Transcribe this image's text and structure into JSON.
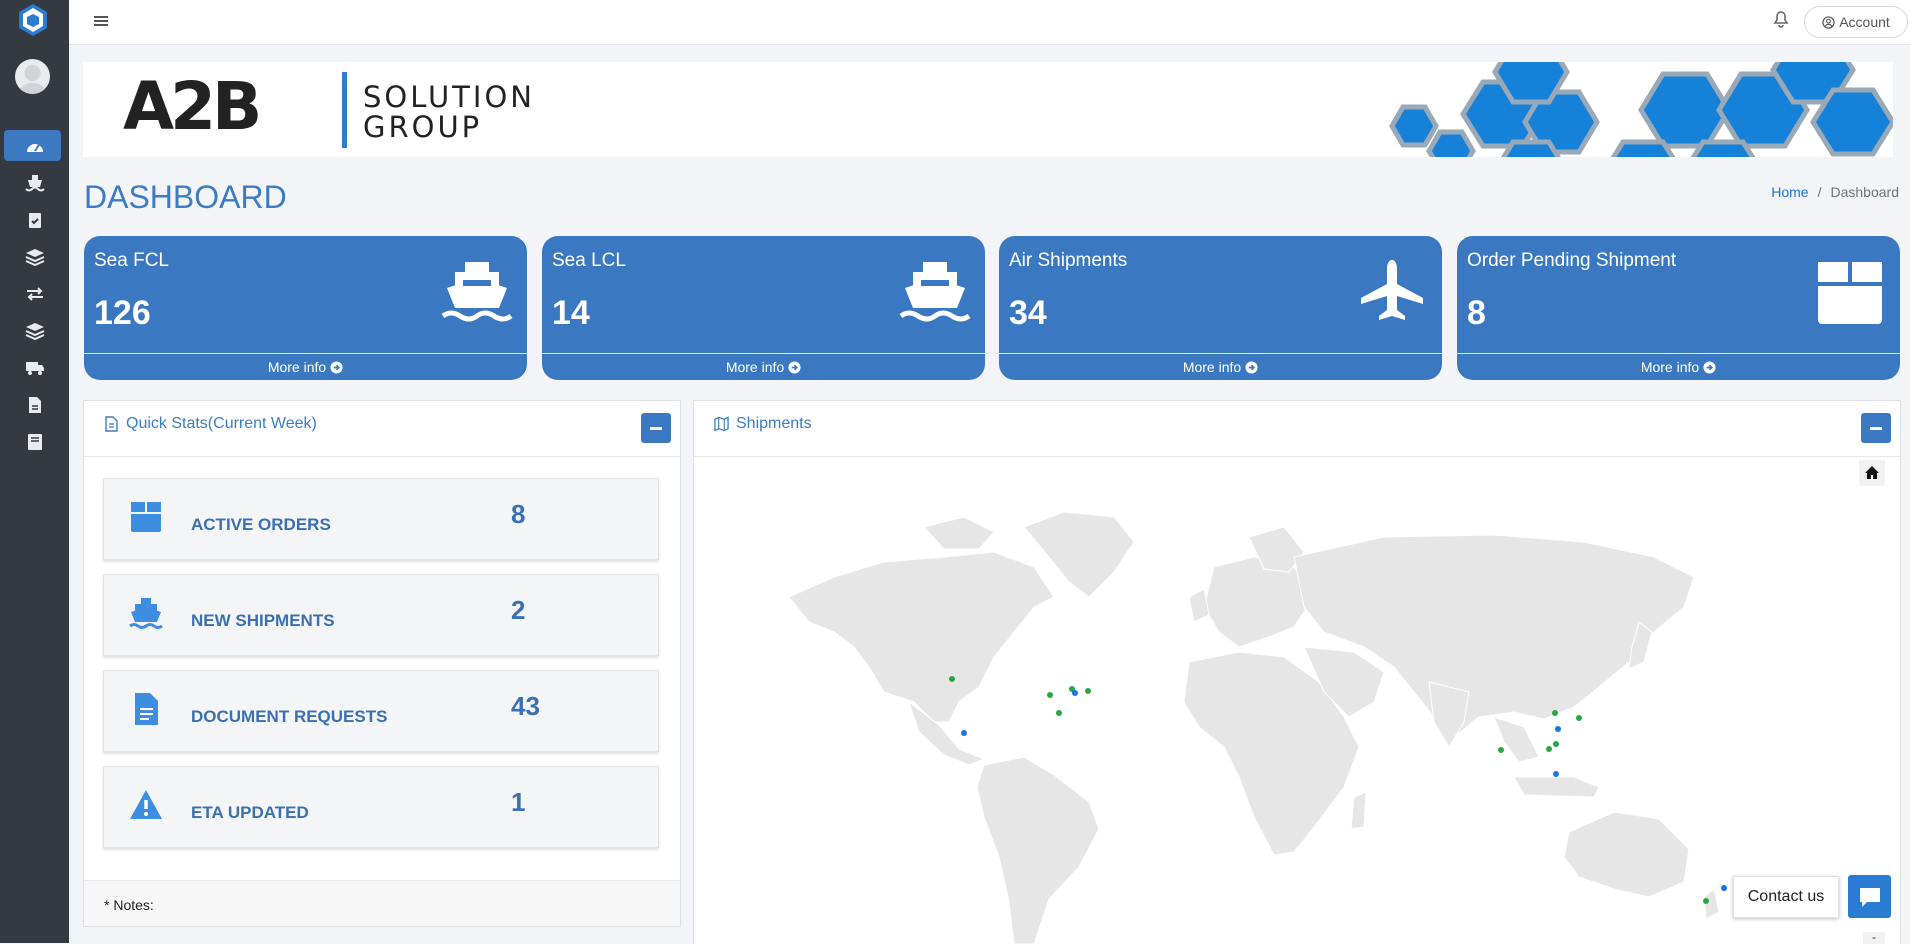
{
  "topbar": {
    "account_label": "Account"
  },
  "banner": {
    "brand_main": "A2B",
    "brand_line1": "SOLUTION",
    "brand_line2": "GROUP"
  },
  "page": {
    "title": "DASHBOARD"
  },
  "breadcrumb": {
    "home": "Home",
    "separator": "/",
    "current": "Dashboard"
  },
  "small_boxes": [
    {
      "label": "Sea FCL",
      "value": "126",
      "icon": "ship-icon",
      "footer": "More info"
    },
    {
      "label": "Sea LCL",
      "value": "14",
      "icon": "ship-icon",
      "footer": "More info"
    },
    {
      "label": "Air Shipments",
      "value": "34",
      "icon": "plane-icon",
      "footer": "More info"
    },
    {
      "label": "Order Pending Shipment",
      "value": "8",
      "icon": "box-icon",
      "footer": "More info"
    }
  ],
  "quick_stats": {
    "title": "Quick Stats(Current Week)",
    "rows": [
      {
        "label": "ACTIVE ORDERS",
        "value": "8",
        "icon": "box-icon"
      },
      {
        "label": "NEW SHIPMENTS",
        "value": "2",
        "icon": "ship-icon"
      },
      {
        "label": "DOCUMENT REQUESTS",
        "value": "43",
        "icon": "document-icon"
      },
      {
        "label": "ETA UPDATED",
        "value": "1",
        "icon": "warning-icon"
      }
    ],
    "notes": "* Notes:"
  },
  "shipments_map": {
    "title": "Shipments",
    "minus_label": "-"
  },
  "contact": {
    "label": "Contact us"
  },
  "colors": {
    "primary": "#3a79c1",
    "sidebar": "#343a40",
    "map_land": "#e6e6e6",
    "dot_green": "#28a745",
    "dot_blue": "#1a73e8"
  }
}
